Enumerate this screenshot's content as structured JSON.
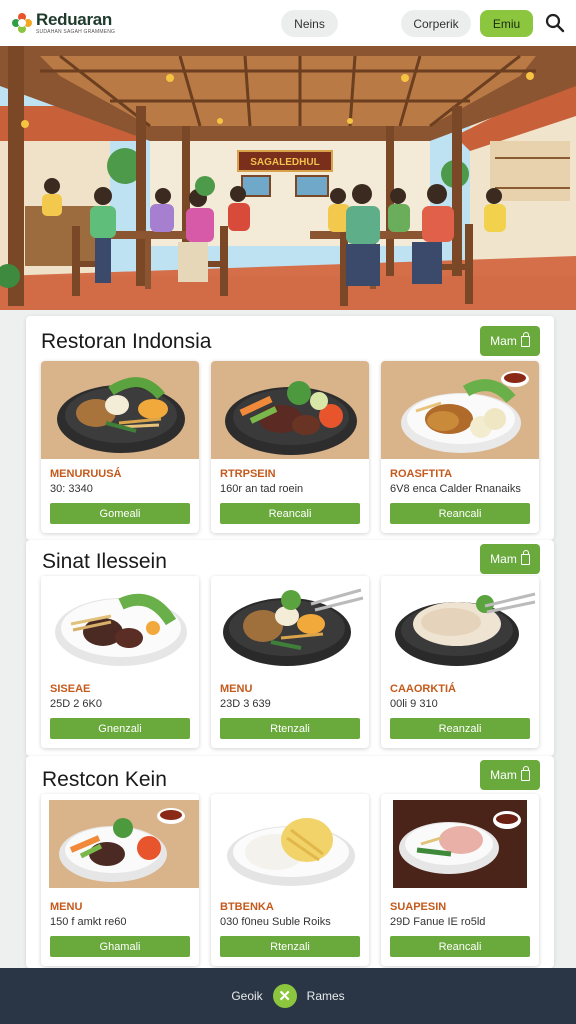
{
  "header": {
    "logo_name": "Reduaran",
    "logo_tagline": "SUDAHAN SAGAH GRAMMENG",
    "nav_label": "Neins",
    "company_label": "Corperik",
    "menu_label": "Emiu",
    "search_icon": "search-icon"
  },
  "hero": {
    "sign_text": "SAGALEDHUL"
  },
  "sections": [
    {
      "title": "Restoran Indonsia",
      "action_label": "Mam",
      "cards": [
        {
          "name": "MENURUUSÁ",
          "desc": "30: 3340",
          "button": "Gomeali"
        },
        {
          "name": "RTRPSEIN",
          "desc": "160r an tad roein",
          "button": "Reancali"
        },
        {
          "name": "ROASFTITA",
          "desc": "6V8 enca Calder Rnanaiks",
          "button": "Reancali"
        }
      ]
    },
    {
      "title": "Sinat Ilessein",
      "action_label": "Mam",
      "cards": [
        {
          "name": "SISEAE",
          "desc": "25D 2 6K0",
          "button": "Gnenzali"
        },
        {
          "name": "MENU",
          "desc": "23D 3 639",
          "button": "Rtenzali"
        },
        {
          "name": "CAAORKTIÁ",
          "desc": "00li 9 310",
          "button": "Reanzali"
        }
      ]
    },
    {
      "title": "Restcon Kein",
      "action_label": "Mam",
      "cards": [
        {
          "name": "MENU",
          "desc": "150 f amkt re60",
          "button": "Ghamali"
        },
        {
          "name": "BTBENKA",
          "desc": "030 f0neu Suble Roiks",
          "button": "Rtenzali"
        },
        {
          "name": "SUAPESIN",
          "desc": "29D Fanue IE ro5ld",
          "button": "Reancali"
        }
      ]
    }
  ],
  "footer": {
    "left_label": "Geoik",
    "right_label": "Rames",
    "close_icon": "close-icon"
  },
  "colors": {
    "accent_green": "#6aaa3c",
    "menu_green": "#8cc63f",
    "item_name_orange": "#c45a1c",
    "footer_bg": "#2a3645"
  }
}
